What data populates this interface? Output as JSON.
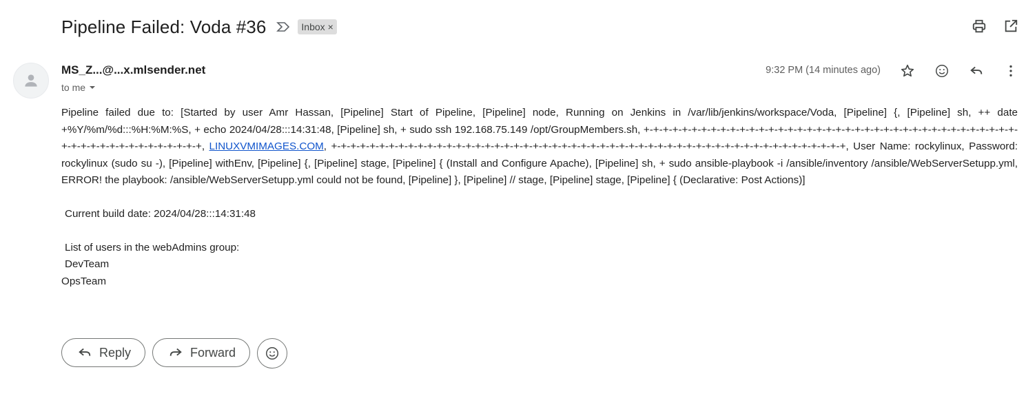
{
  "subject": "Pipeline Failed: Voda #36",
  "label": {
    "name": "Inbox",
    "remove": "×"
  },
  "sender": {
    "display": "MS_Z...@...x.mlsender.net",
    "to": "to me"
  },
  "time": "9:32 PM (14 minutes ago)",
  "body": {
    "para1_before_link": "Pipeline failed due to: [Started by user Amr Hassan, [Pipeline] Start of Pipeline, [Pipeline] node, Running on Jenkins in /var/lib/jenkins/workspace/Voda, [Pipeline] {, [Pipeline] sh, ++ date +%Y/%m/%d:::%H:%M:%S, + echo 2024/04/28:::14:31:48, [Pipeline] sh, + sudo ssh 192.168.75.149 /opt/GroupMembers.sh, +-+-+-+-+-+-+-+-+-+-+-+-+-+-+-+-+-+-+-+-+-+-+-+-+-+-+-+-+-+-+-+-+-+-+-+-+-+-+-+-+-+-+-+-+-+-+-+-+-+-+-+-+-+, ",
    "link": "LINUXVMIMAGES.COM",
    "para1_after_link": ", +-+-+-+-+-+-+-+-+-+-+-+-+-+-+-+-+-+-+-+-+-+-+-+-+-+-+-+-+-+-+-+-+-+-+-+-+-+-+-+-+-+-+-+-+-+-+-+-+-+-+-+-+-+, User Name: rockylinux, Password: rockylinux (sudo su -), [Pipeline] withEnv, [Pipeline] {, [Pipeline] stage, [Pipeline] { (Install and Configure Apache), [Pipeline] sh, + sudo ansible-playbook -i /ansible/inventory /ansible/WebServerSetupp.yml, ERROR! the playbook: /ansible/WebServerSetupp.yml could not be found, [Pipeline] }, [Pipeline] // stage, [Pipeline] stage, [Pipeline] { (Declarative: Post Actions)]",
    "build_date": "Current build date:  2024/04/28:::14:31:48",
    "users_heading": "List of users in the webAdmins group:",
    "user1": "DevTeam",
    "user2": "OpsTeam"
  },
  "buttons": {
    "reply": "Reply",
    "forward": "Forward"
  },
  "icons": {
    "importance": "importance-marker-icon",
    "print": "print-icon",
    "open_new_window": "open-in-new-window-icon",
    "star": "star-icon",
    "emoji": "emoji-reaction-icon",
    "reply": "reply-icon",
    "more": "more-vert-icon"
  },
  "colors": {
    "link": "#1155cc",
    "chip_bg": "#dddddd",
    "text": "#222222"
  }
}
